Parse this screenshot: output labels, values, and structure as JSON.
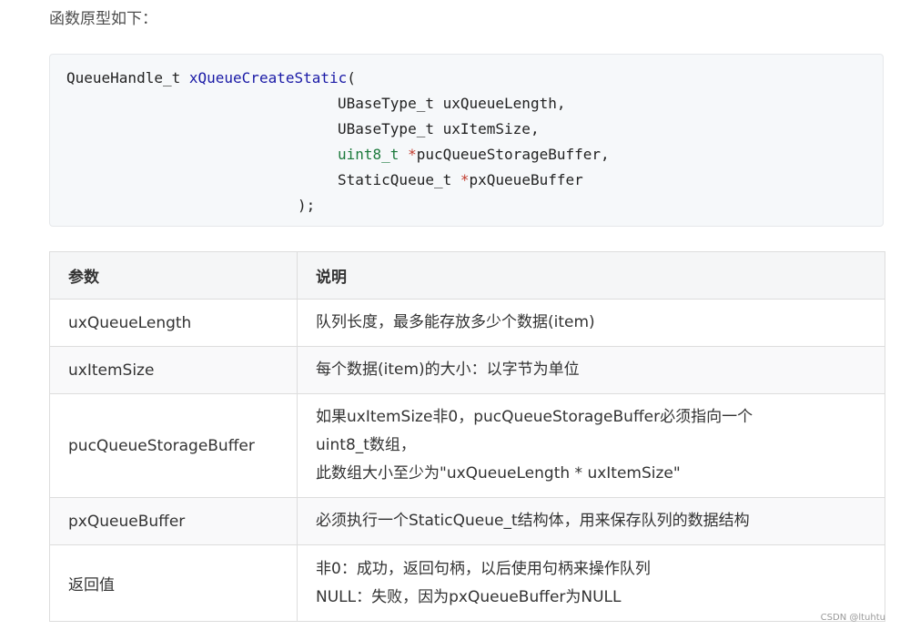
{
  "intro": "函数原型如下：",
  "code": {
    "return_type": "QueueHandle_t",
    "fn_name": "xQueueCreateStatic",
    "open_paren": "(",
    "p1_type": "UBaseType_t",
    "p1_name": "uxQueueLength,",
    "p2_type": "UBaseType_t",
    "p2_name": "uxItemSize,",
    "p3_type": "uint8_t",
    "p3_star": "*",
    "p3_name": "pucQueueStorageBuffer,",
    "p4_type": "StaticQueue_t",
    "p4_star": "*",
    "p4_name": "pxQueueBuffer",
    "close": ");"
  },
  "table": {
    "headers": [
      "参数",
      "说明"
    ],
    "rows": [
      {
        "param": "uxQueueLength",
        "desc": [
          "队列长度，最多能存放多少个数据(item)"
        ]
      },
      {
        "param": "uxItemSize",
        "desc": [
          "每个数据(item)的大小：以字节为单位"
        ]
      },
      {
        "param": "pucQueueStorageBuffer",
        "desc": [
          "如果uxItemSize非0，pucQueueStorageBuffer必须指向一个",
          "uint8_t数组，",
          "此数组大小至少为\"uxQueueLength * uxItemSize\""
        ]
      },
      {
        "param": "pxQueueBuffer",
        "desc": [
          "必须执行一个StaticQueue_t结构体，用来保存队列的数据结构"
        ]
      },
      {
        "param": "返回值",
        "desc": [
          "非0：成功，返回句柄，以后使用句柄来操作队列",
          "NULL：失败，因为pxQueueBuffer为NULL"
        ]
      }
    ]
  },
  "watermark": "CSDN @ltuhtu"
}
